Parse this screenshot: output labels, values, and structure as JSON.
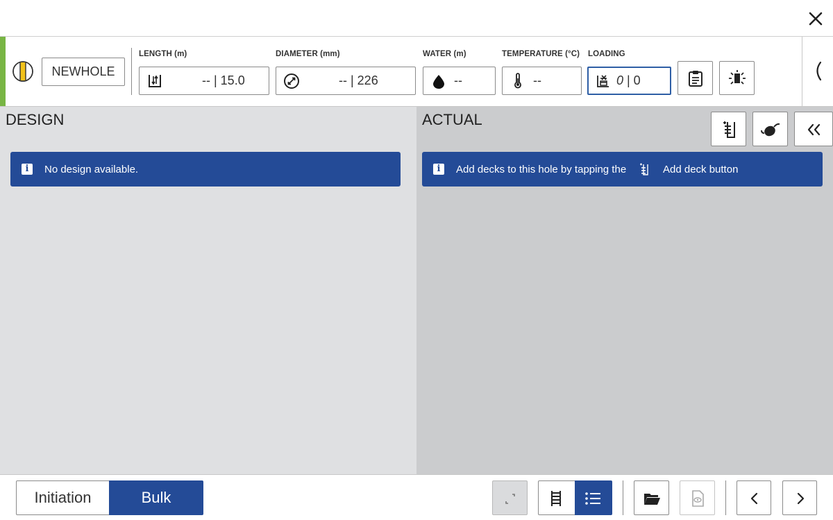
{
  "header": {
    "hole_name": "NEWHOLE",
    "fields": {
      "length": {
        "label": "LENGTH (m)",
        "value": "-- | 15.0"
      },
      "diameter": {
        "label": "DIAMETER (mm)",
        "value": "-- | 226"
      },
      "water": {
        "label": "WATER (m)",
        "value": "--"
      },
      "temperature": {
        "label": "TEMPERATURE (°C)",
        "value": "--"
      },
      "loading": {
        "label": "LOADING",
        "value_primary": "0",
        "value_secondary": "| 0"
      }
    },
    "status_color": "#78b544"
  },
  "design": {
    "title": "DESIGN",
    "banner": "No design available."
  },
  "actual": {
    "title": "ACTUAL",
    "banner_before": "Add decks to this hole by tapping the",
    "banner_after": "Add deck button"
  },
  "bottom": {
    "tabs": [
      {
        "label": "Initiation",
        "active": false
      },
      {
        "label": "Bulk",
        "active": true
      }
    ]
  },
  "colors": {
    "accent": "#244b97",
    "design_bg": "#dfe0e2",
    "actual_bg": "#cbccce"
  }
}
